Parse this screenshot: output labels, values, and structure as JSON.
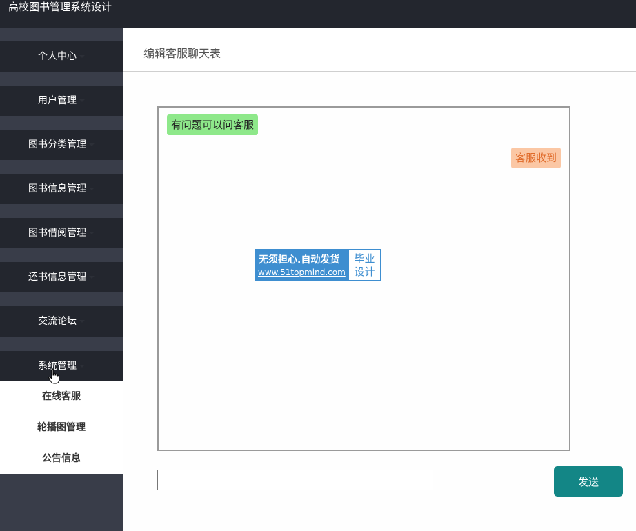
{
  "app": {
    "title": "高校图书管理系统设计"
  },
  "sidebar": {
    "items": [
      {
        "label": "个人中心"
      },
      {
        "label": "用户管理"
      },
      {
        "label": "图书分类管理"
      },
      {
        "label": "图书信息管理"
      },
      {
        "label": "图书借阅管理"
      },
      {
        "label": "还书信息管理"
      },
      {
        "label": "交流论坛"
      },
      {
        "label": "系统管理"
      }
    ],
    "submenu": [
      {
        "label": "在线客服"
      },
      {
        "label": "轮播图管理"
      },
      {
        "label": "公告信息"
      }
    ]
  },
  "page": {
    "title": "编辑客服聊天表"
  },
  "chat": {
    "messages": [
      {
        "side": "left",
        "text": "有问题可以问客服"
      },
      {
        "side": "right",
        "text": "客服收到"
      }
    ],
    "watermark": {
      "line1": "无须担心.自动发货",
      "line2": "www.51topmind.com",
      "badge_line1": "毕业",
      "badge_line2": "设计"
    }
  },
  "composer": {
    "input_value": "",
    "send_label": "发送"
  },
  "colors": {
    "topbar": "#23262e",
    "sidebar_bg": "#393d49",
    "menu_item": "#23262e",
    "send_button": "#138686",
    "bubble_left": "#8ee88a",
    "bubble_right": "#fbc7a4"
  }
}
